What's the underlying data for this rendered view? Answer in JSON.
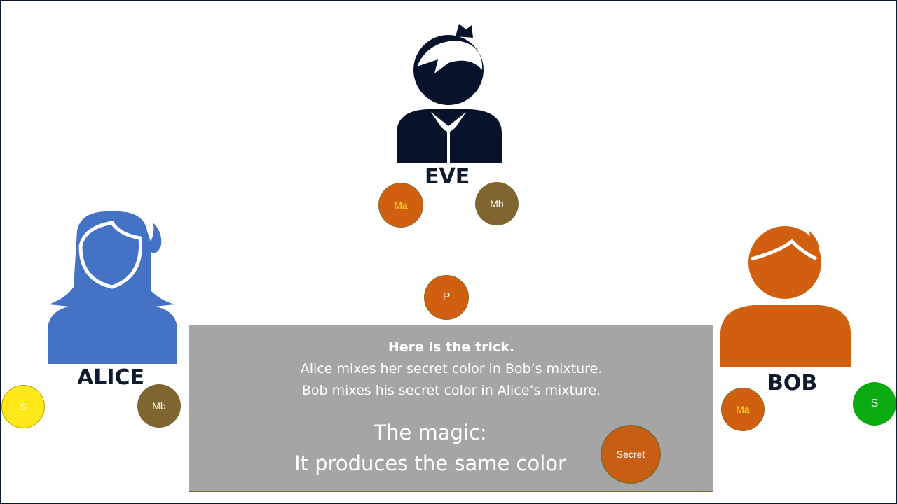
{
  "people": {
    "eve": "EVE",
    "alice": "ALICE",
    "bob": "BOB"
  },
  "circles": {
    "alice_secret": "S",
    "alice_mb": "Mb",
    "eve_ma": "Ma",
    "eve_mb": "Mb",
    "public": "P",
    "bob_ma": "Ma",
    "bob_secret": "S",
    "shared_secret": "Secret"
  },
  "text": {
    "heading": "Here is the trick.",
    "line1": "Alice mixes her secret color in Bob’s mixture.",
    "line2": "Bob mixes his secret color in Alice’s mixture.",
    "magic1": "The magic:",
    "magic2": "It produces the same color"
  },
  "colors": {
    "alice": "#4472C4",
    "bob": "#D06010",
    "eve": "#06132B",
    "yellow": "#FFE81A",
    "brown": "#7F6530",
    "green": "#0AAA10",
    "gray": "#A5A5A5"
  }
}
